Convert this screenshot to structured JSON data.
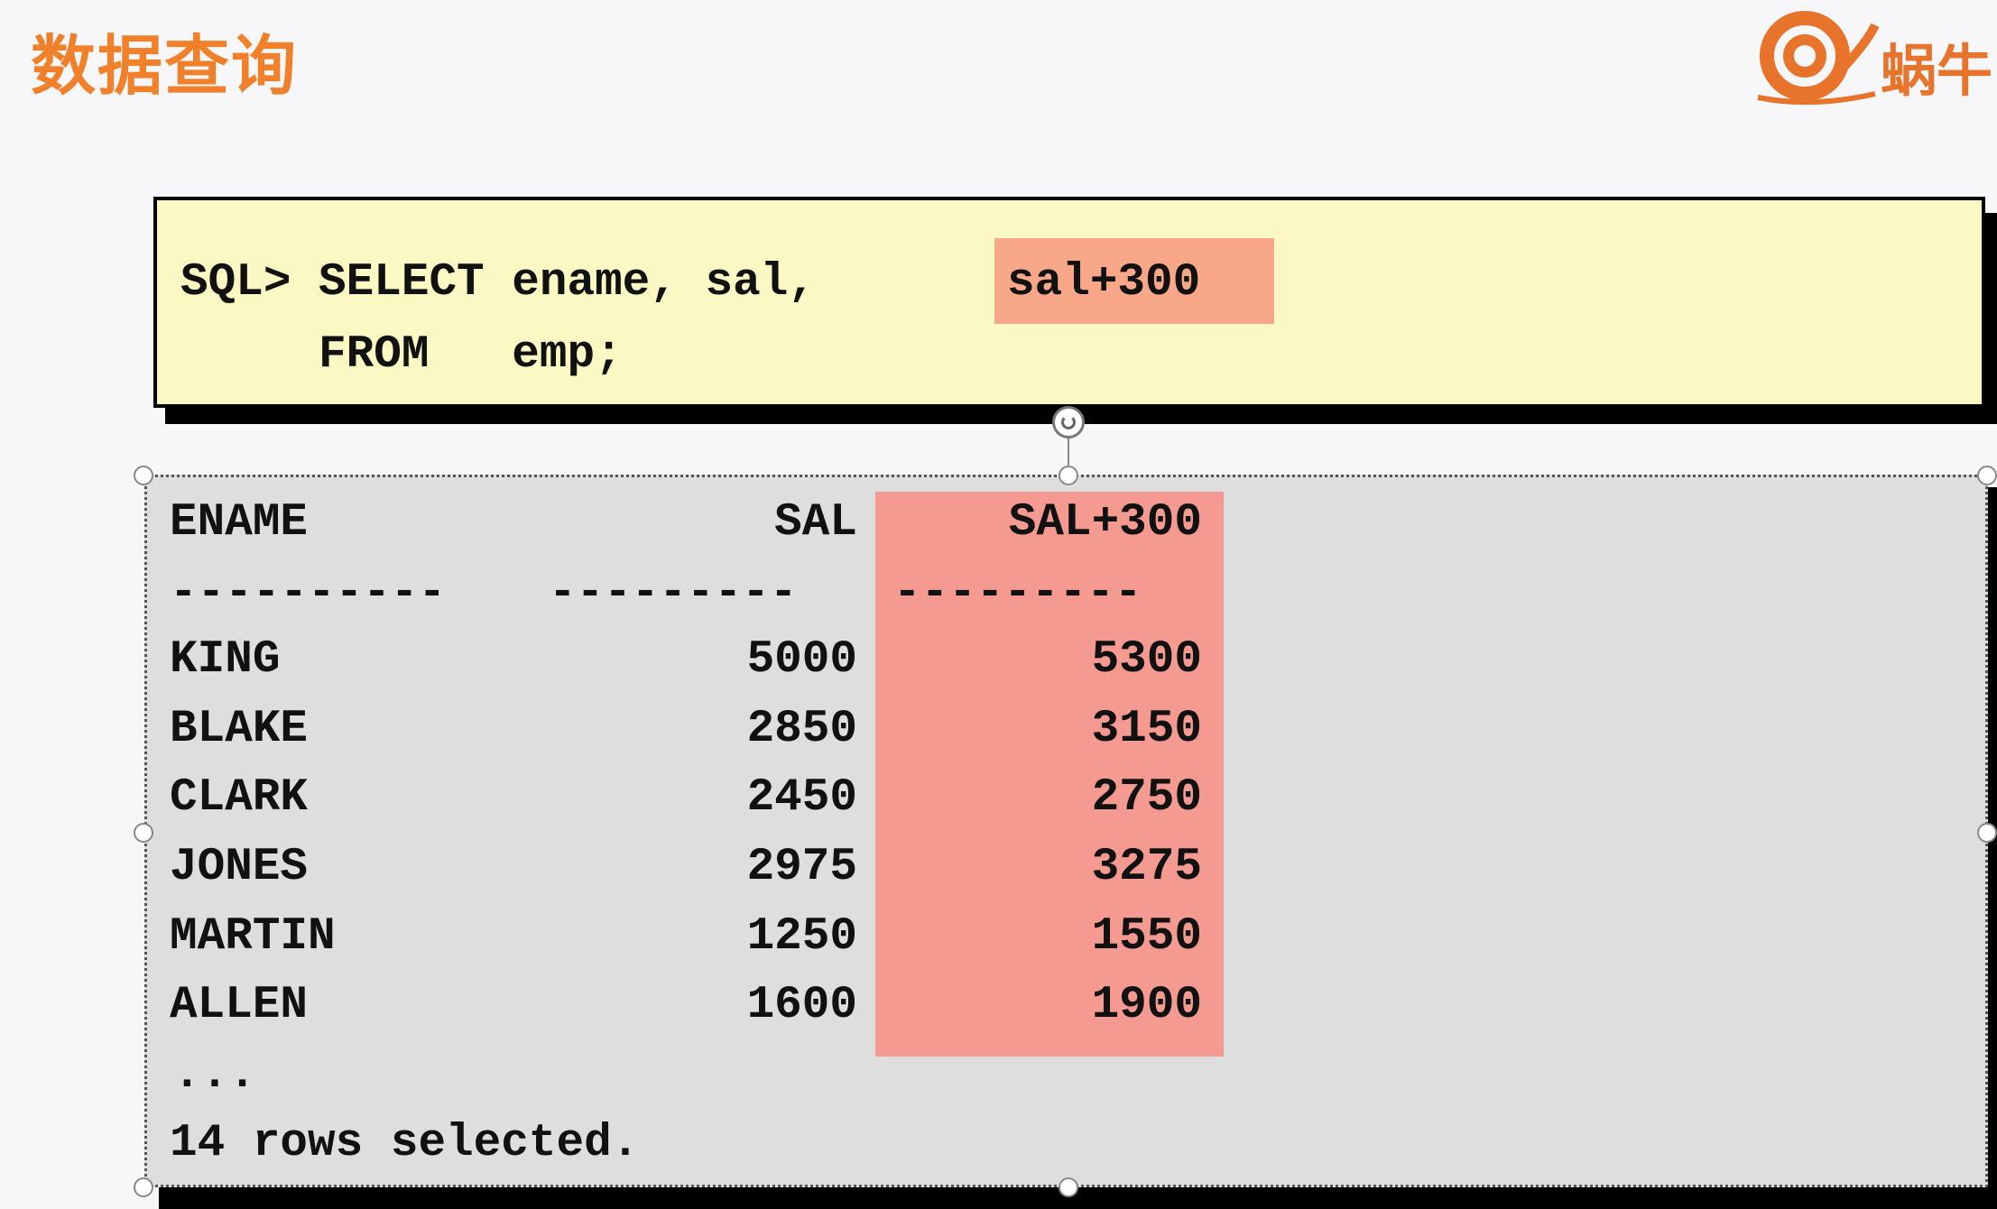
{
  "slide": {
    "title": "数据查询",
    "logo_text": "蜗牛"
  },
  "sql": {
    "line1_prefix": "SQL> SELECT ename, sal,",
    "line1_highlight": "sal+300",
    "line2": "     FROM   emp;"
  },
  "result": {
    "headers": [
      "ENAME",
      "SAL",
      "SAL+300"
    ],
    "separators": [
      "----------",
      "---------",
      "---------"
    ],
    "rows": [
      [
        "KING",
        "5000",
        "5300"
      ],
      [
        "BLAKE",
        "2850",
        "3150"
      ],
      [
        "CLARK",
        "2450",
        "2750"
      ],
      [
        "JONES",
        "2975",
        "3275"
      ],
      [
        "MARTIN",
        "1250",
        "1550"
      ],
      [
        "ALLEN",
        "1600",
        "1900"
      ]
    ],
    "ellipsis": "...",
    "footer": "14 rows selected."
  },
  "colors": {
    "title": "#f0802a",
    "sql_background": "#fcf8c4",
    "sql_highlight": "#f8a888",
    "column_highlight": "#f49a90",
    "result_background": "#dedede"
  }
}
